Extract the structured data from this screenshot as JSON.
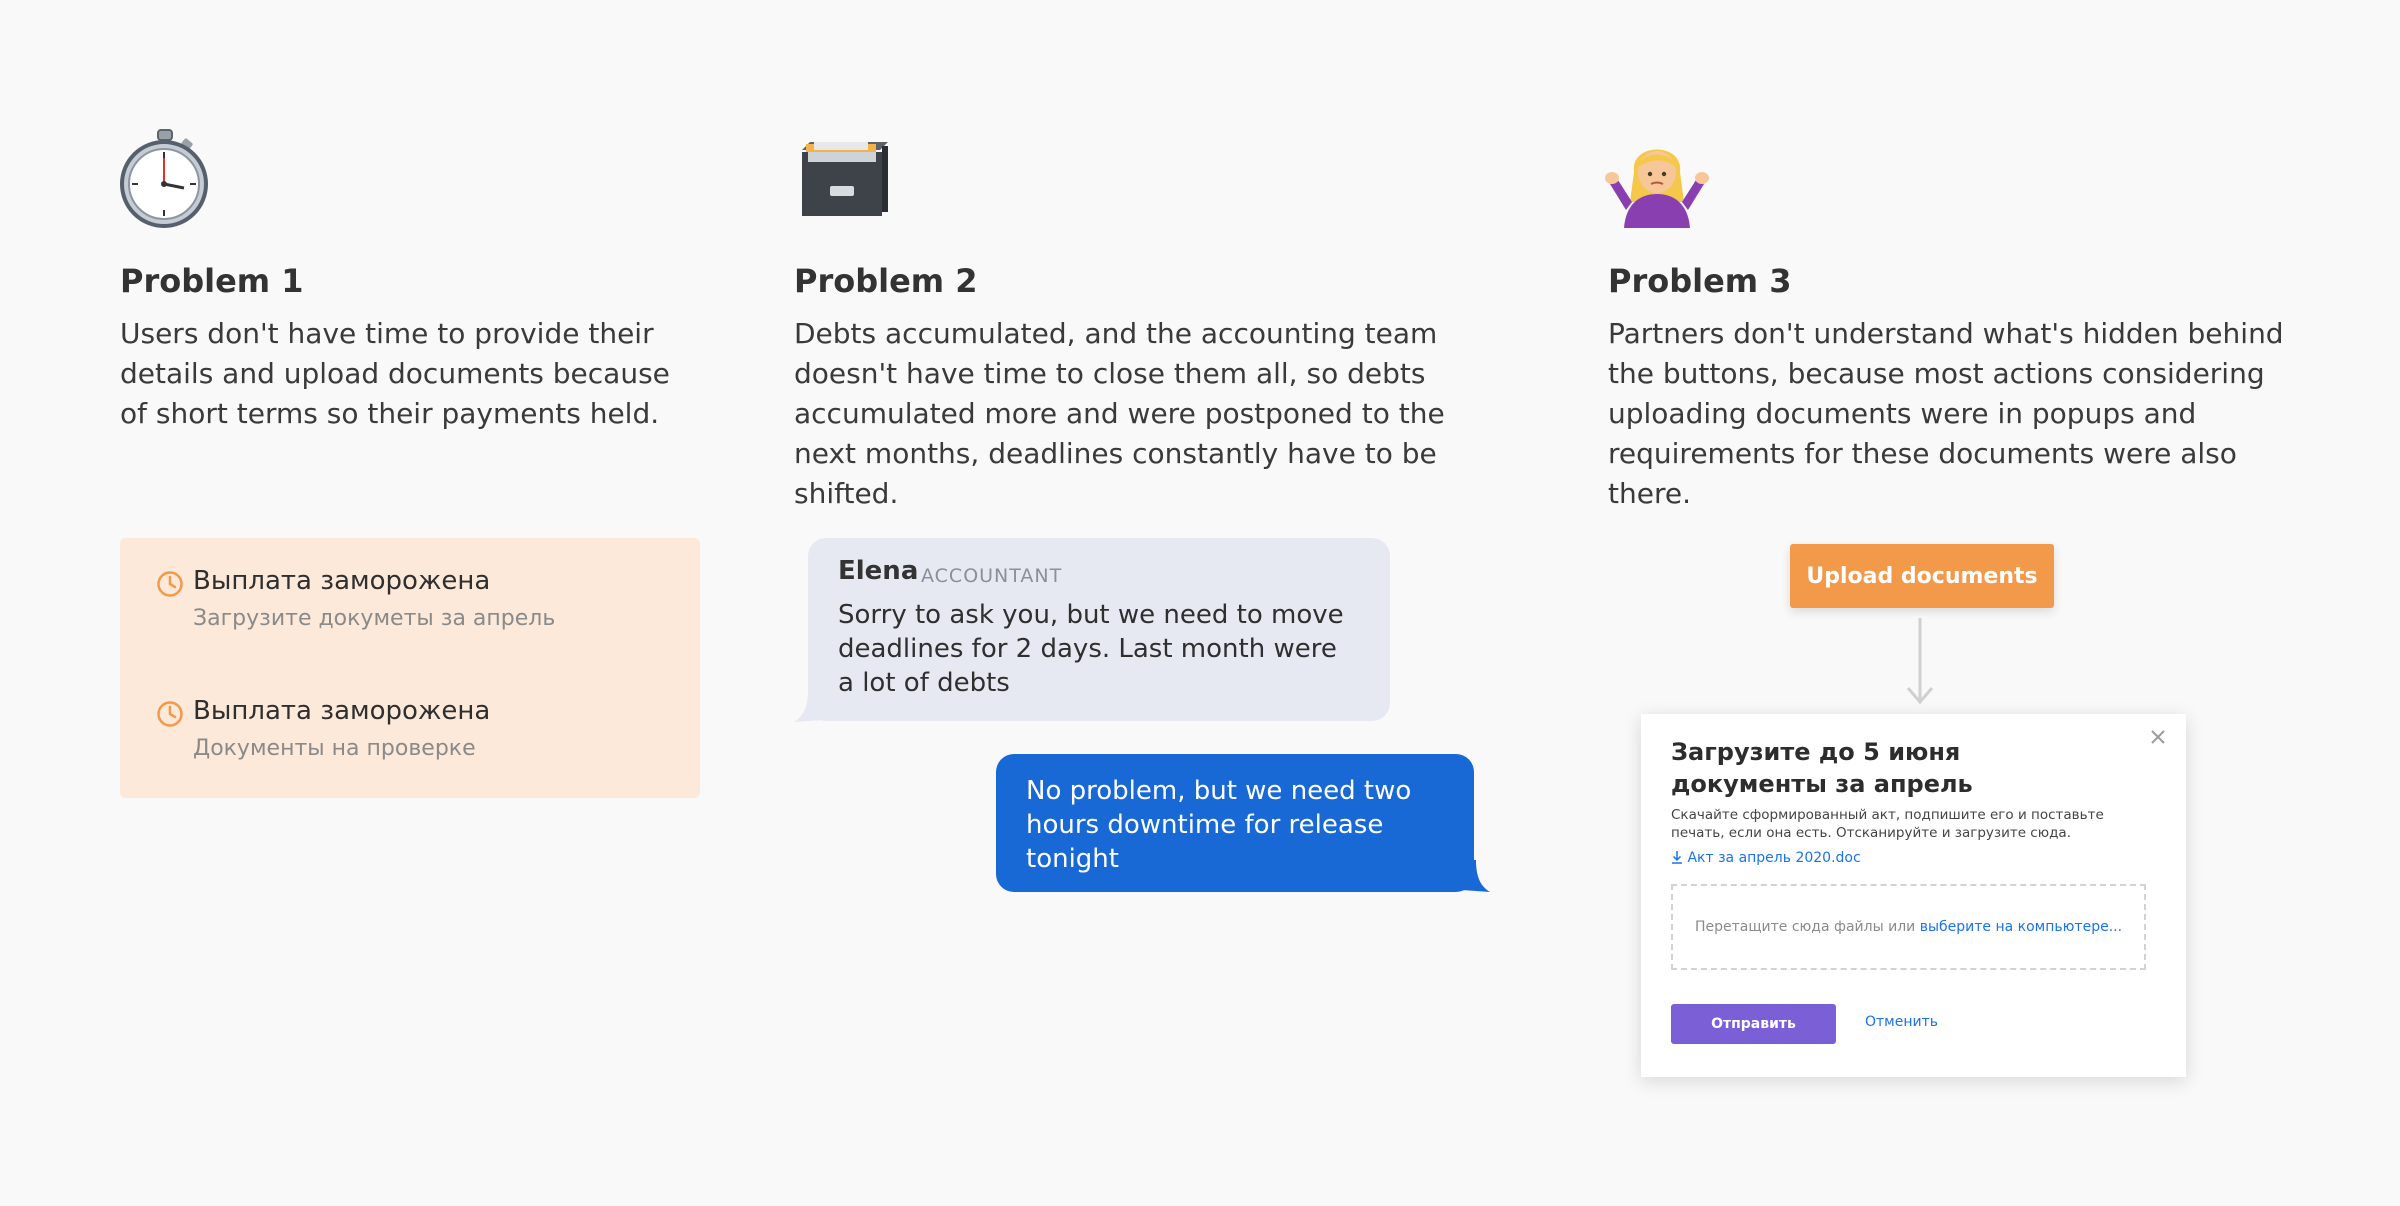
{
  "problems": [
    {
      "icon": "stopwatch-icon",
      "title": "Problem 1",
      "text": "Users don't have time to provide their details and upload documents because of short terms so their payments held."
    },
    {
      "icon": "card-file-box-icon",
      "title": "Problem 2",
      "text": "Debts accumulated, and the accounting team doesn't have time to close them all, so debts accumulated more and were postponed to the next months, deadlines constantly have to be shifted."
    },
    {
      "icon": "shrugging-woman-icon",
      "title": "Problem 3",
      "text": "Partners don't understand what's hidden behind the buttons, because most actions considering uploading documents were in popups and requirements for these documents were also there."
    }
  ],
  "freeze_card": {
    "items": [
      {
        "title": "Выплата заморожена",
        "subtitle": "Загрузите докуметы за апрель"
      },
      {
        "title": "Выплата заморожена",
        "subtitle": "Документы на проверке"
      }
    ]
  },
  "chat": {
    "incoming": {
      "name": "Elena",
      "role": "ACCOUNTANT",
      "text": "Sorry to ask you, but we need to move deadlines for 2 days. Last month were a lot of debts"
    },
    "outgoing": {
      "text": "No problem, but we need two hours downtime for release tonight"
    }
  },
  "upload": {
    "button_label": "Upload documents",
    "modal": {
      "title": "Загрузите до 5 июня документы за апрель",
      "description": "Скачайте сформированный акт, подпишите его и поставьте печать, если она есть. Отсканируйте и загрузите сюда.",
      "file_link": "Акт за апрель 2020.doc",
      "dropzone_text": "Перетащите сюда файлы или",
      "dropzone_link": "выберите на компьютере...",
      "submit_label": "Отправить",
      "cancel_label": "Отменить"
    }
  },
  "colors": {
    "freeze_bg": "#fce9da",
    "clock_accent": "#f2994a",
    "bubble_gray": "#e6e9f1",
    "bubble_blue": "#1868d6",
    "upload_button": "#f2994a",
    "submit_button": "#7b5fd6",
    "link": "#1a73e8"
  }
}
